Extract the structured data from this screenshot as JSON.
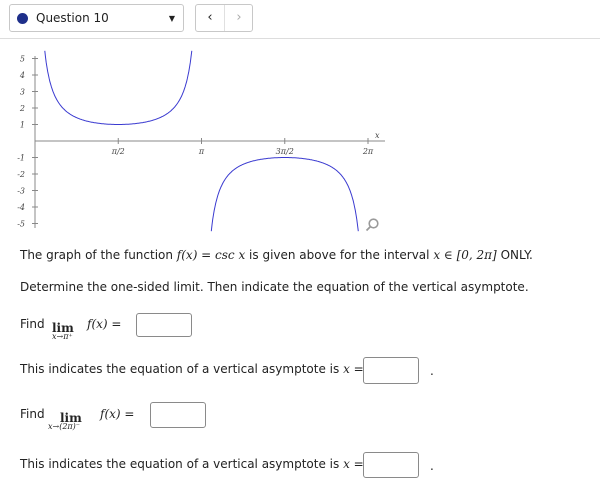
{
  "question": {
    "label": "Question 10",
    "prev_icon": "chevron-left-icon",
    "next_icon": "chevron-right-icon"
  },
  "graph": {
    "y_ticks": [
      "5",
      "4",
      "3",
      "2",
      "1",
      "-1",
      "-2",
      "-3",
      "-4",
      "-5"
    ],
    "x_ticks": [
      "π/2",
      "π",
      "3π/2",
      "2π"
    ],
    "x_axis_label": "x",
    "curve_color": "#3a3ad0",
    "function": "csc x",
    "x_range": [
      0,
      6.2832
    ],
    "y_range": [
      -5.5,
      5.5
    ]
  },
  "intro": {
    "p1a": "The graph of the function ",
    "p1b": "f(x) = csc x",
    "p1c": " is given above for the interval ",
    "p1d": "x ∈ [0, 2π]",
    "p1e": " ONLY.",
    "p2": "Determine the one-sided limit. Then indicate the equation of the vertical asymptote."
  },
  "q1": {
    "find": "Find",
    "lim": "lim",
    "sub": "x→π⁺",
    "expr": "f(x) =",
    "answer": "",
    "asym_text": "This indicates the equation of a vertical asymptote is ",
    "asym_var": "x =",
    "asym_answer": "",
    "period": "."
  },
  "q2": {
    "find": "Find",
    "lim": "lim",
    "sub": "x→(2π)⁻",
    "expr": "f(x) =",
    "answer": "",
    "asym_text": "This indicates the equation of a vertical asymptote is ",
    "asym_var": "x =",
    "asym_answer": "",
    "period": "."
  }
}
